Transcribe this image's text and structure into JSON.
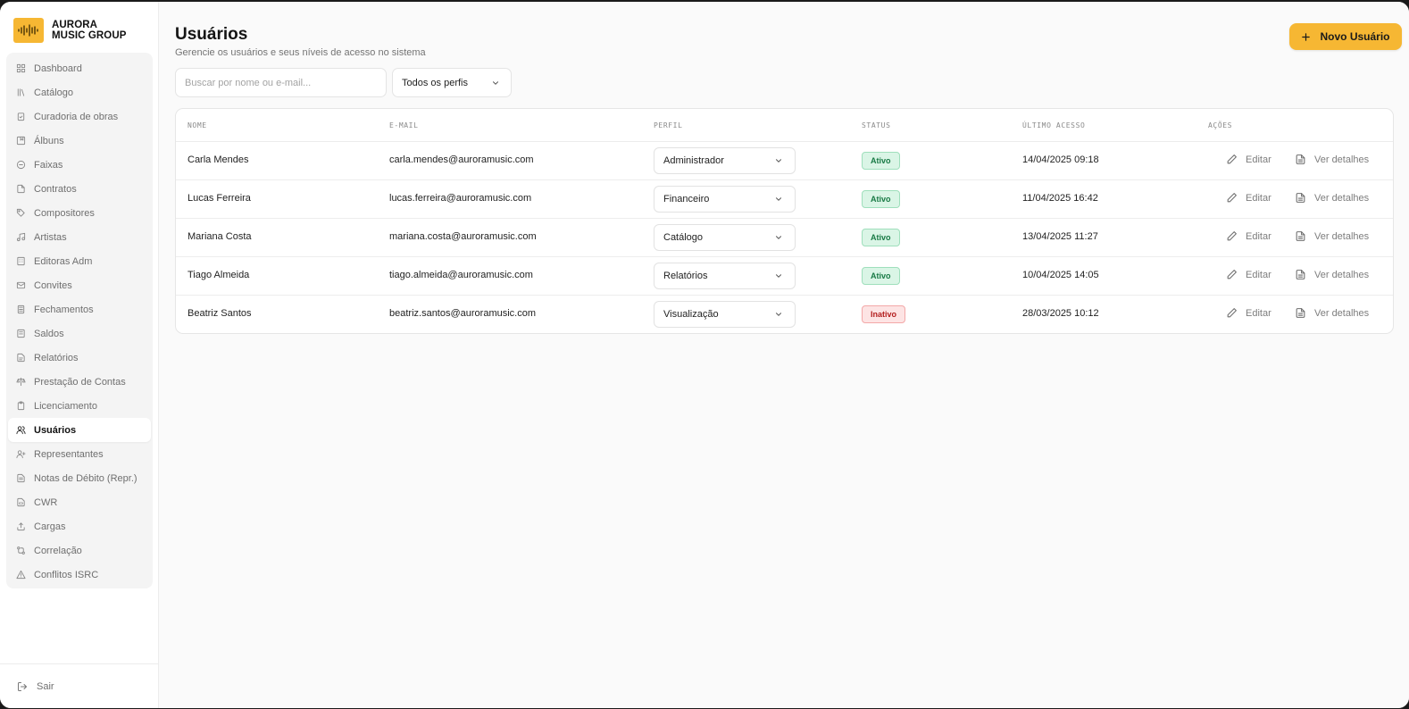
{
  "brand": {
    "line1": "AURORA",
    "line2": "MUSIC GROUP"
  },
  "sidebar": {
    "items": [
      {
        "label": "Dashboard",
        "icon": "grid-icon"
      },
      {
        "label": "Catálogo",
        "icon": "library-icon"
      },
      {
        "label": "Curadoria de obras",
        "icon": "clipboard-check-icon"
      },
      {
        "label": "Álbuns",
        "icon": "album-icon"
      },
      {
        "label": "Faixas",
        "icon": "disc-icon"
      },
      {
        "label": "Contratos",
        "icon": "file-icon"
      },
      {
        "label": "Compositores",
        "icon": "tag-icon"
      },
      {
        "label": "Artistas",
        "icon": "music-note-icon"
      },
      {
        "label": "Editoras Adm",
        "icon": "building-icon"
      },
      {
        "label": "Convites",
        "icon": "mail-icon"
      },
      {
        "label": "Fechamentos",
        "icon": "calculator-icon"
      },
      {
        "label": "Saldos",
        "icon": "wallet-icon"
      },
      {
        "label": "Relatórios",
        "icon": "file-text-icon"
      },
      {
        "label": "Prestação de Contas",
        "icon": "scale-icon"
      },
      {
        "label": "Licenciamento",
        "icon": "clipboard-icon"
      },
      {
        "label": "Usuários",
        "icon": "users-icon",
        "active": true
      },
      {
        "label": "Representantes",
        "icon": "user-plus-icon"
      },
      {
        "label": "Notas de Débito (Repr.)",
        "icon": "receipt-icon"
      },
      {
        "label": "CWR",
        "icon": "file-code-icon"
      },
      {
        "label": "Cargas",
        "icon": "upload-icon"
      },
      {
        "label": "Correlação",
        "icon": "git-compare-icon"
      },
      {
        "label": "Conflitos ISRC",
        "icon": "alert-triangle-icon"
      }
    ],
    "logout_label": "Sair"
  },
  "page": {
    "title": "Usuários",
    "subtitle": "Gerencie os usuários e seus níveis de acesso no sistema",
    "new_button": "Novo Usuário"
  },
  "filters": {
    "search_placeholder": "Buscar por nome ou e-mail...",
    "profile_selected": "Todos os perfis"
  },
  "table": {
    "columns": [
      "NOME",
      "E-MAIL",
      "PERFIL",
      "STATUS",
      "ÚLTIMO ACESSO",
      "AÇÕES"
    ],
    "edit_label": "Editar",
    "details_label": "Ver detalhes",
    "rows": [
      {
        "name": "Carla Mendes",
        "email": "carla.mendes@auroramusic.com",
        "role": "Administrador",
        "status": "Ativo",
        "last_access": "14/04/2025 09:18"
      },
      {
        "name": "Lucas Ferreira",
        "email": "lucas.ferreira@auroramusic.com",
        "role": "Financeiro",
        "status": "Ativo",
        "last_access": "11/04/2025 16:42"
      },
      {
        "name": "Mariana Costa",
        "email": "mariana.costa@auroramusic.com",
        "role": "Catálogo",
        "status": "Ativo",
        "last_access": "13/04/2025 11:27"
      },
      {
        "name": "Tiago Almeida",
        "email": "tiago.almeida@auroramusic.com",
        "role": "Relatórios",
        "status": "Ativo",
        "last_access": "10/04/2025 14:05"
      },
      {
        "name": "Beatriz Santos",
        "email": "beatriz.santos@auroramusic.com",
        "role": "Visualização",
        "status": "Inativo",
        "last_access": "28/03/2025 10:12"
      }
    ]
  },
  "colors": {
    "accent": "#f6b733",
    "active_badge": "#daf5e6",
    "inactive_badge": "#fde4e4"
  }
}
